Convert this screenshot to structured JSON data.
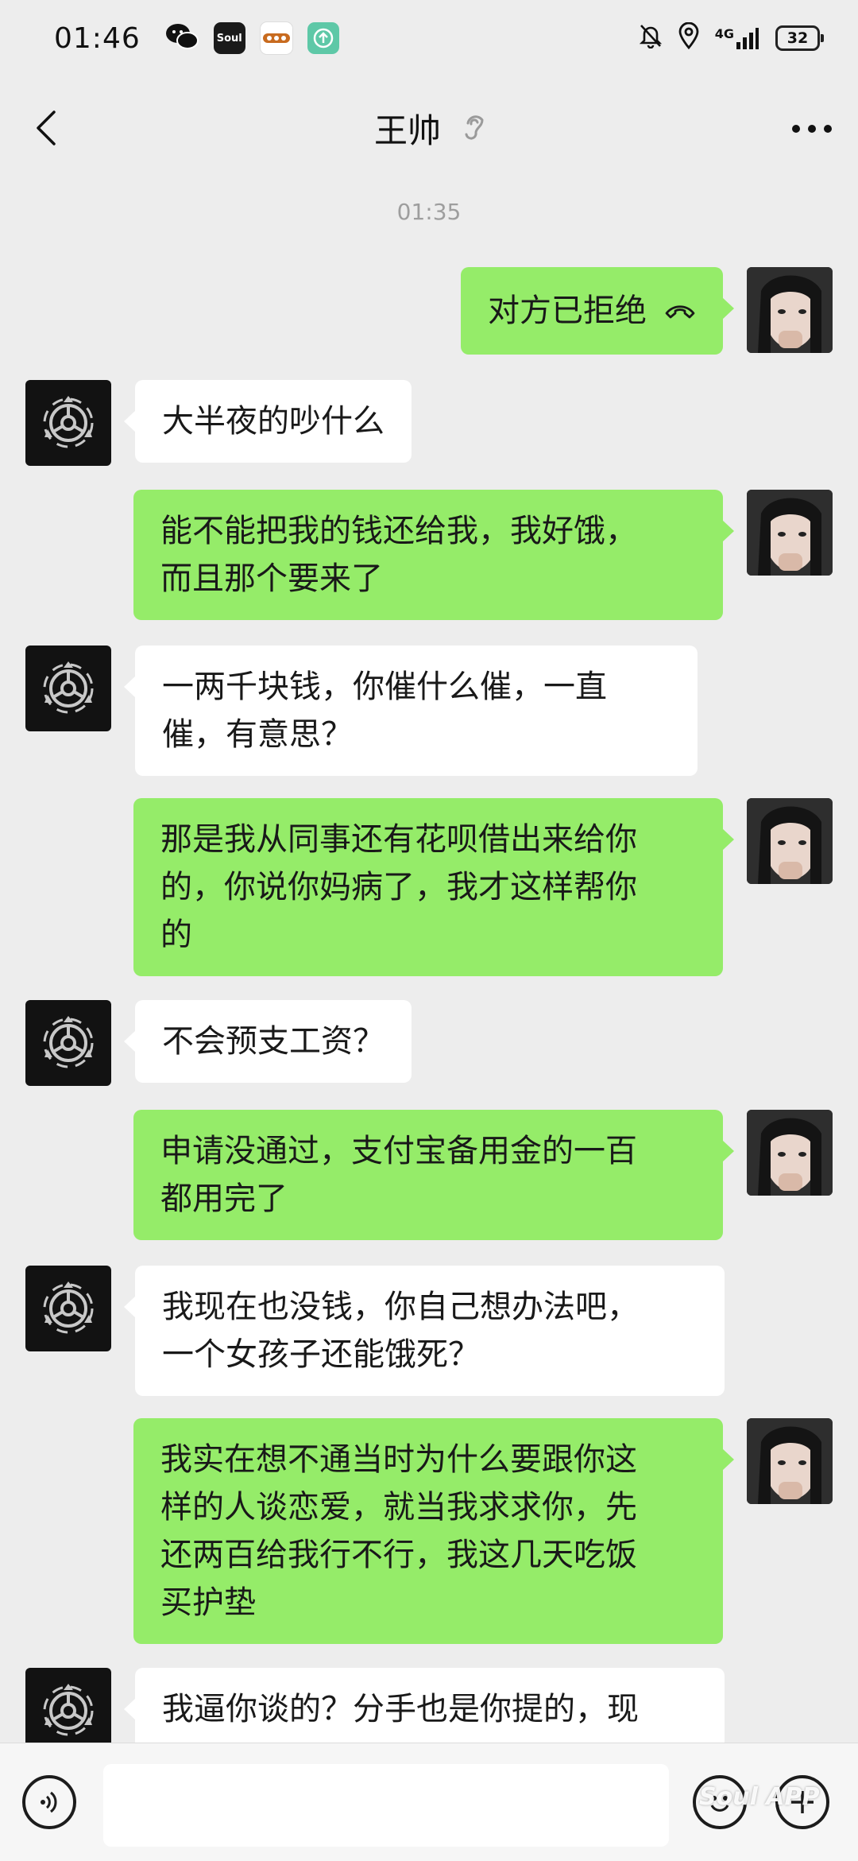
{
  "status_bar": {
    "time": "01:46",
    "apps": [
      "wechat-icon",
      "soul-app-icon",
      "game-app-icon",
      "update-app-icon"
    ],
    "soul_label": "Soul",
    "network": "4G",
    "battery": "32"
  },
  "header": {
    "title": "王帅",
    "muted_icon": "earpiece-icon"
  },
  "chat": {
    "timestamp": "01:35",
    "call_status": "对方已拒绝",
    "messages": [
      {
        "side": "in",
        "text": "大半夜的吵什么"
      },
      {
        "side": "out",
        "text": "能不能把我的钱还给我，我好饿，\n而且那个要来了"
      },
      {
        "side": "in",
        "text": "一两千块钱，你催什么催，一直\n催，有意思？"
      },
      {
        "side": "out",
        "text": "那是我从同事还有花呗借出来给你\n的，你说你妈病了，我才这样帮你\n的"
      },
      {
        "side": "in",
        "text": "不会预支工资？"
      },
      {
        "side": "out",
        "text": "申请没通过，支付宝备用金的一百\n都用完了"
      },
      {
        "side": "in",
        "text": "我现在也没钱，你自己想办法吧，\n一个女孩子还能饿死？"
      },
      {
        "side": "out",
        "text": "我实在想不通当时为什么要跟你这\n样的人谈恋爱，就当我求求你，先\n还两百给我行不行，我这几天吃饭\n买护垫"
      },
      {
        "side": "in",
        "text": "我逼你谈的？分手也是你提的，现"
      }
    ]
  },
  "input_bar": {
    "value": "",
    "watermark": "Soul APP"
  },
  "colors": {
    "background": "#ededed",
    "outgoing_bubble": "#95ec69",
    "incoming_bubble": "#ffffff"
  }
}
